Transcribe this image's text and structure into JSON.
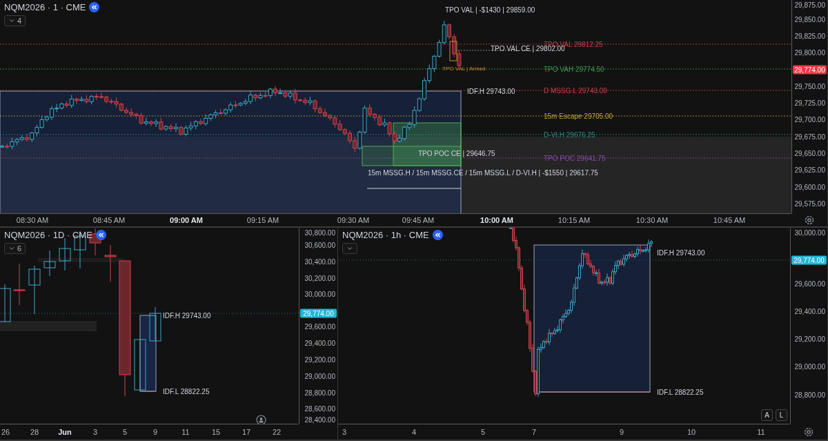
{
  "main_chart": {
    "title": "NQM2026 · 1 · CME",
    "indicator_count": "4",
    "levels": [
      {
        "text": "TPO VAL  29812.25",
        "color": "#c8414b"
      },
      {
        "text": "TPO VAH  29774.50",
        "color": "#3f9b4c"
      },
      {
        "text": "D MSSG.L  29743.00",
        "color": "#c8414b"
      },
      {
        "text": "15m Escape  29705.00",
        "color": "#c9a53a"
      },
      {
        "text": "D-VI.H  29676.25",
        "color": "#2f8f86"
      },
      {
        "text": "TPO POC  29641.75",
        "color": "#8e4ba8"
      }
    ],
    "annotations": [
      {
        "kind": "label",
        "text": "TPO VAL | -$1430 | 29859.00"
      },
      {
        "kind": "label",
        "text": "TPO VAL CE | 29802.00"
      },
      {
        "kind": "alert",
        "text": "TPO VAL | Armed"
      },
      {
        "kind": "label",
        "text": "IDF.H 29743.00"
      },
      {
        "kind": "label",
        "text": "TPO POC CE | 29646.75"
      },
      {
        "kind": "label",
        "text": "15m MSSG.H / 15m MSSG.CE / 15m MSSG.L / D-VI.H | -$1550 | 29617.75"
      }
    ],
    "price_axis": [
      "29,875.00",
      "29,850.00",
      "29,825.00",
      "29,800.00",
      "29,750.00",
      "29,725.00",
      "29,700.00",
      "29,675.00",
      "29,650.00",
      "29,625.00",
      "29,600.00",
      "29,575.00"
    ],
    "current_price": {
      "label": "29,774.00",
      "color": "#f23645"
    },
    "time_axis": [
      {
        "label": "08:30 AM",
        "bold": false
      },
      {
        "label": "08:45 AM",
        "bold": false
      },
      {
        "label": "09:00 AM",
        "bold": true
      },
      {
        "label": "09:15 AM",
        "bold": false
      },
      {
        "label": "09:30 AM",
        "bold": false
      },
      {
        "label": "09:45 AM",
        "bold": false
      },
      {
        "label": "10:00 AM",
        "bold": true
      },
      {
        "label": "10:15 AM",
        "bold": false
      },
      {
        "label": "10:30 AM",
        "bold": false
      },
      {
        "label": "10:45 AM",
        "bold": false
      }
    ]
  },
  "daily_chart": {
    "title": "NQM2026 · 1D · CME",
    "indicator_count": "6",
    "annotations": [
      {
        "text": "IDF.H 29743.00"
      },
      {
        "text": "IDF.L 28822.25"
      }
    ],
    "price_axis": [
      "30,800.00",
      "30,600.00",
      "30,400.00",
      "30,200.00",
      "30,000.00",
      "29,600.00",
      "29,400.00",
      "29,200.00",
      "29,000.00",
      "28,800.00",
      "28,600.00",
      "28,400.00"
    ],
    "current_price": {
      "label": "29,774.00",
      "color": "#22b6d4"
    },
    "time_axis": [
      {
        "label": "26",
        "bold": false
      },
      {
        "label": "28",
        "bold": false
      },
      {
        "label": "Jun",
        "bold": true
      },
      {
        "label": "3",
        "bold": false
      },
      {
        "label": "5",
        "bold": false
      },
      {
        "label": "9",
        "bold": false
      },
      {
        "label": "11",
        "bold": false
      },
      {
        "label": "15",
        "bold": false
      },
      {
        "label": "17",
        "bold": false
      },
      {
        "label": "22",
        "bold": false
      }
    ]
  },
  "hourly_chart": {
    "title": "NQM2026 · 1h · CME",
    "annotations": [
      {
        "text": "IDF.H 29743.00"
      },
      {
        "text": "IDF.L 28822.25"
      }
    ],
    "price_axis": [
      "30,000.00",
      "29,600.00",
      "29,400.00",
      "29,200.00",
      "29,000.00",
      "28,800.00"
    ],
    "current_price": {
      "label": "29,774.00",
      "color": "#22b6d4"
    },
    "scale_buttons": [
      "A",
      "L"
    ],
    "time_axis": [
      {
        "label": "3",
        "bold": false
      },
      {
        "label": "4",
        "bold": false
      },
      {
        "label": "5",
        "bold": false
      },
      {
        "label": "7",
        "bold": false
      },
      {
        "label": "9",
        "bold": false
      },
      {
        "label": "10",
        "bold": false
      },
      {
        "label": "11",
        "bold": false
      }
    ]
  }
}
